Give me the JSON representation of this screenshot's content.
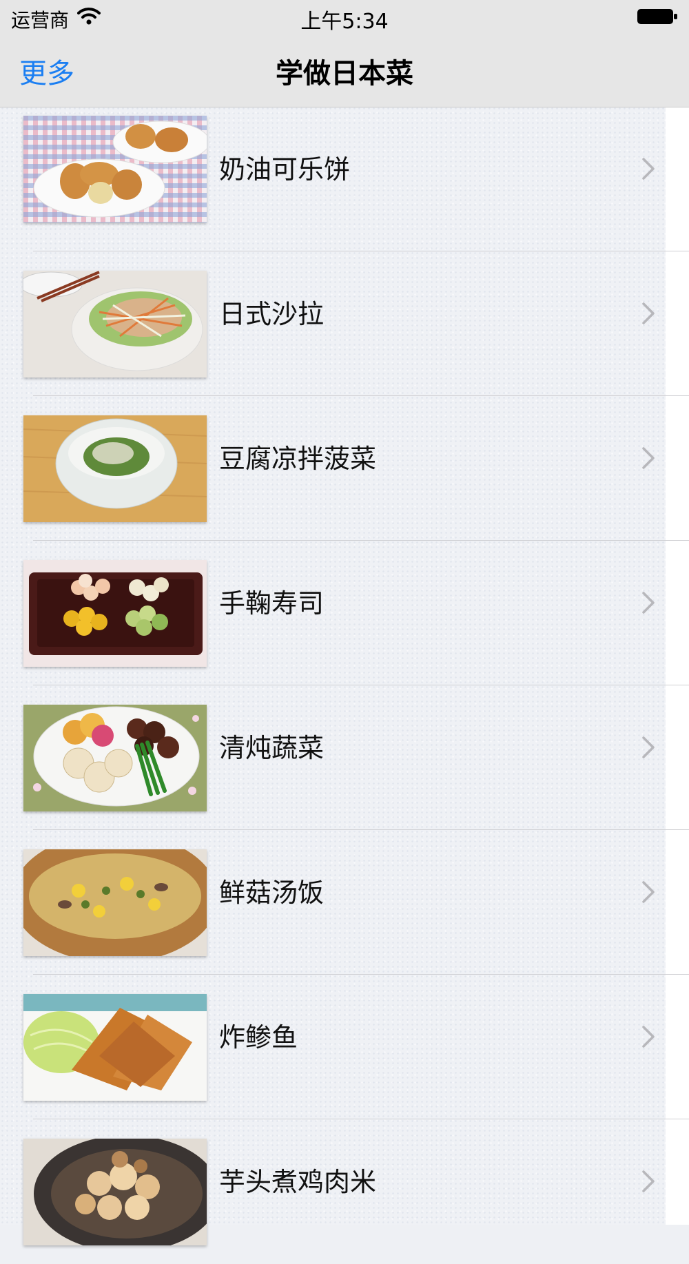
{
  "status_bar": {
    "carrier": "运营商",
    "time": "上午5:34"
  },
  "nav": {
    "back_label": "更多",
    "title": "学做日本菜"
  },
  "recipes": [
    {
      "name": "奶油可乐饼"
    },
    {
      "name": "日式沙拉"
    },
    {
      "name": "豆腐凉拌菠菜"
    },
    {
      "name": "手鞠寿司"
    },
    {
      "name": "清炖蔬菜"
    },
    {
      "name": "鲜菇汤饭"
    },
    {
      "name": "炸鲹鱼"
    },
    {
      "name": "芋头煮鸡肉米"
    }
  ],
  "colors": {
    "accent": "#1a7ef2",
    "nav_background": "#e6e6e6"
  }
}
